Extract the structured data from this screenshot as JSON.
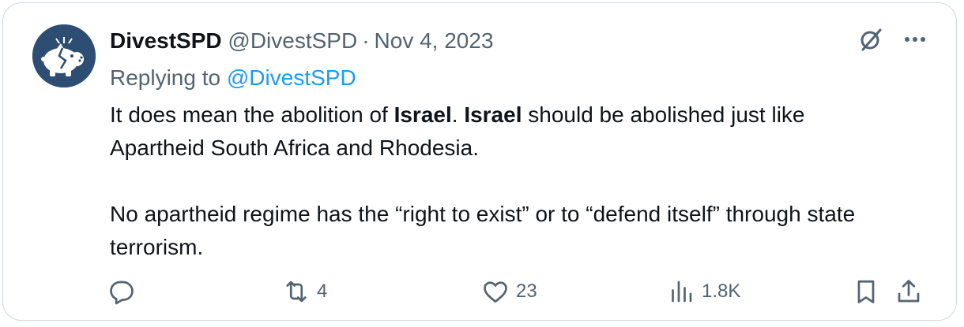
{
  "tweet": {
    "display_name": "DivestSPD",
    "handle": "@DivestSPD",
    "separator": "·",
    "date": "Nov 4, 2023",
    "replying_to_prefix": "Replying to ",
    "replying_to_handle": "@DivestSPD",
    "body": {
      "p1_part1": "It does mean the abolition of ",
      "p1_bold1": "Israel",
      "p1_part2": ". ",
      "p1_bold2": "Israel",
      "p1_part3": " should be abolished just like Apartheid South Africa and Rhodesia.",
      "p2": "No apartheid regime has the “right to exist” or to “defend itself” through state terrorism."
    }
  },
  "actions": {
    "reply_count": "",
    "retweet_count": "4",
    "like_count": "23",
    "views_count": "1.8K"
  },
  "icons": {
    "top": [
      "grok-slash-icon",
      "more-icon"
    ],
    "actions": [
      "reply-icon",
      "retweet-icon",
      "like-icon",
      "views-icon",
      "bookmark-icon",
      "share-icon"
    ]
  },
  "colors": {
    "text": "#0f1419",
    "secondary": "#536471",
    "link": "#1d9bf0",
    "border": "#cfd9de",
    "avatar_bg": "#2d4d72"
  }
}
